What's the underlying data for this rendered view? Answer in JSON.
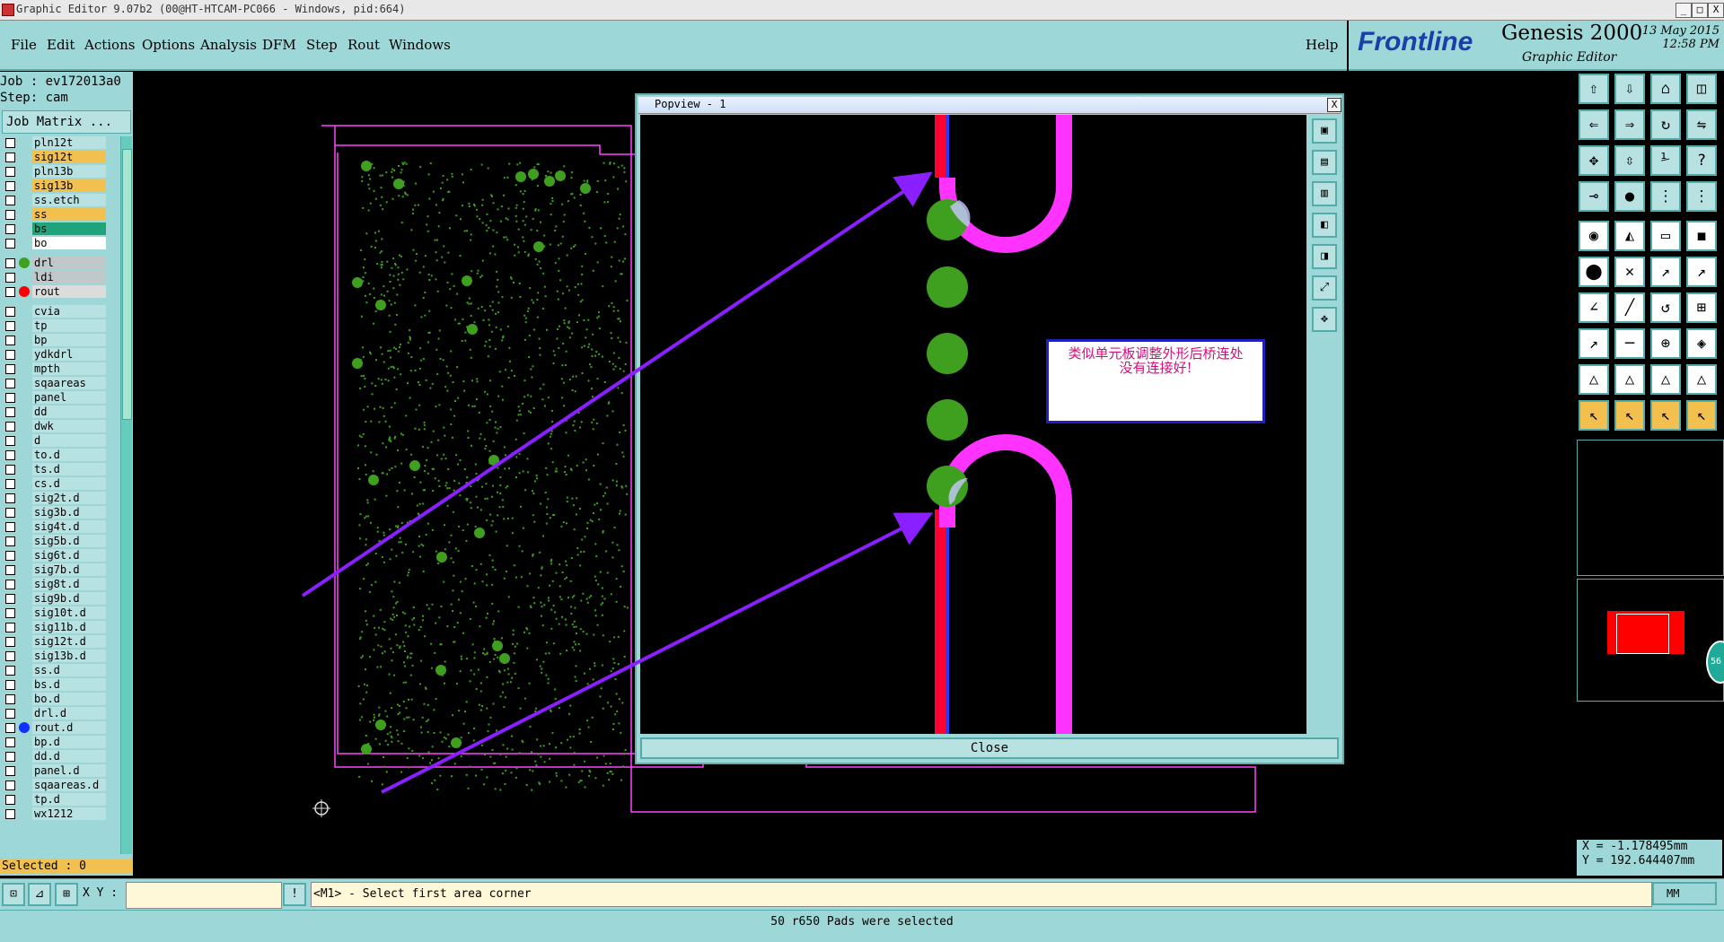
{
  "window": {
    "title": "Graphic Editor 9.07b2 (00@HT-HTCAM-PC066 - Windows, pid:664)",
    "minimize": "_",
    "maximize": "□",
    "close": "X"
  },
  "menu": {
    "items": [
      "File",
      "Edit",
      "Actions",
      "Options",
      "Analysis",
      "DFM",
      "Step",
      "Rout",
      "Windows"
    ],
    "help": "Help"
  },
  "brand": {
    "logo": "Frontline",
    "product": "Genesis 2000",
    "subtitle": "Graphic Editor",
    "date": "13 May 2015",
    "time": "12:58 PM"
  },
  "job": {
    "job_label": "Job : ev172013a0",
    "step_label": "Step: cam",
    "matrix_button": "Job Matrix ..."
  },
  "layers": [
    {
      "name": "pln12t",
      "color": "#b8e2e2",
      "dot": ""
    },
    {
      "name": "sig12t",
      "color": "#f2c04f",
      "dot": ""
    },
    {
      "name": "pln13b",
      "color": "#b8e2e2",
      "dot": ""
    },
    {
      "name": "sig13b",
      "color": "#f2c04f",
      "dot": ""
    },
    {
      "name": "ss.etch",
      "color": "#b8e2e2",
      "dot": ""
    },
    {
      "name": "ss",
      "color": "#f2c04f",
      "dot": ""
    },
    {
      "name": "bs",
      "color": "#1fa37a",
      "dot": ""
    },
    {
      "name": "bo",
      "color": "#ffffff",
      "dot": "",
      "flag": "✎"
    },
    {
      "name": "drl",
      "color": "#c0c8c8",
      "dot": "#3f9f1f",
      "flag": "▪"
    },
    {
      "name": "ldi",
      "color": "#c0c8c8",
      "dot": ""
    },
    {
      "name": "rout",
      "color": "#dcdcdc",
      "dot": "#ff0000"
    },
    {
      "name": "cvia",
      "color": "#b8e2e2",
      "dot": ""
    },
    {
      "name": "tp",
      "color": "#b8e2e2",
      "dot": ""
    },
    {
      "name": "bp",
      "color": "#b8e2e2",
      "dot": ""
    },
    {
      "name": "ydkdrl",
      "color": "#b8e2e2",
      "dot": ""
    },
    {
      "name": "mpth",
      "color": "#b8e2e2",
      "dot": ""
    },
    {
      "name": "sqaareas",
      "color": "#b8e2e2",
      "dot": ""
    },
    {
      "name": "panel",
      "color": "#b8e2e2",
      "dot": "",
      "flag": "✎"
    },
    {
      "name": "dd",
      "color": "#b8e2e2",
      "dot": "",
      "flag": "✎"
    },
    {
      "name": "dwk",
      "color": "#b8e2e2",
      "dot": ""
    },
    {
      "name": "d",
      "color": "#b8e2e2",
      "dot": ""
    },
    {
      "name": "to.d",
      "color": "#b8e2e2",
      "dot": "",
      "flag": "✎"
    },
    {
      "name": "ts.d",
      "color": "#b8e2e2",
      "dot": ""
    },
    {
      "name": "cs.d",
      "color": "#b8e2e2",
      "dot": ""
    },
    {
      "name": "sig2t.d",
      "color": "#b8e2e2",
      "dot": ""
    },
    {
      "name": "sig3b.d",
      "color": "#b8e2e2",
      "dot": ""
    },
    {
      "name": "sig4t.d",
      "color": "#b8e2e2",
      "dot": ""
    },
    {
      "name": "sig5b.d",
      "color": "#b8e2e2",
      "dot": ""
    },
    {
      "name": "sig6t.d",
      "color": "#b8e2e2",
      "dot": ""
    },
    {
      "name": "sig7b.d",
      "color": "#b8e2e2",
      "dot": ""
    },
    {
      "name": "sig8t.d",
      "color": "#b8e2e2",
      "dot": ""
    },
    {
      "name": "sig9b.d",
      "color": "#b8e2e2",
      "dot": ""
    },
    {
      "name": "sig10t.d",
      "color": "#b8e2e2",
      "dot": ""
    },
    {
      "name": "sig11b.d",
      "color": "#b8e2e2",
      "dot": ""
    },
    {
      "name": "sig12t.d",
      "color": "#b8e2e2",
      "dot": ""
    },
    {
      "name": "sig13b.d",
      "color": "#b8e2e2",
      "dot": ""
    },
    {
      "name": "ss.d",
      "color": "#b8e2e2",
      "dot": ""
    },
    {
      "name": "bs.d",
      "color": "#b8e2e2",
      "dot": ""
    },
    {
      "name": "bo.d",
      "color": "#b8e2e2",
      "dot": "",
      "flag": "✎"
    },
    {
      "name": "drl.d",
      "color": "#b8e2e2",
      "dot": ""
    },
    {
      "name": "rout.d",
      "color": "#b8e2e2",
      "dot": "#1030ff"
    },
    {
      "name": "bp.d",
      "color": "#b8e2e2",
      "dot": ""
    },
    {
      "name": "dd.d",
      "color": "#b8e2e2",
      "dot": "",
      "flag": "✎"
    },
    {
      "name": "panel.d",
      "color": "#b8e2e2",
      "dot": "",
      "flag": "✎"
    },
    {
      "name": "sqaareas.d",
      "color": "#b8e2e2",
      "dot": ""
    },
    {
      "name": "tp.d",
      "color": "#b8e2e2",
      "dot": ""
    },
    {
      "name": "wx1212",
      "color": "#b8e2e2",
      "dot": ""
    }
  ],
  "selected_label": "Selected : 0",
  "popview": {
    "title": "Popview - 1",
    "close_label": "Close",
    "note_line1": "类似单元板调整外形后桥连处",
    "note_line2": "没有连接好!"
  },
  "coords": {
    "x": "X = -1.178495mm",
    "y": "Y = 192.644407mm"
  },
  "bottom": {
    "xy_label": "X Y :",
    "xy_value": "",
    "prompt": "<M1> - Select first area corner",
    "units": "MM",
    "warn_icon": "!"
  },
  "status": "50 r650 Pads were selected",
  "badge": "56",
  "colors": {
    "panel": "#9ed7d7",
    "highlight": "#f2c04f",
    "magenta": "#ff33ff",
    "pad_green": "#3f9f1f",
    "arrow": "#8a1fff"
  }
}
